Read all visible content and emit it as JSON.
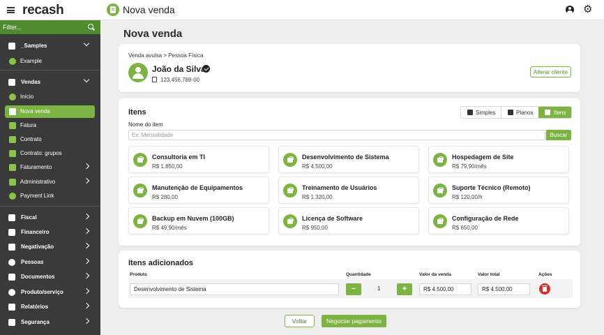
{
  "app": {
    "logo": "recash",
    "page_title": "Nova venda"
  },
  "sidebar": {
    "filter_placeholder": "Filter...",
    "groups": [
      {
        "label": "_Samples",
        "icon": "folder-icon"
      },
      {
        "label": "Example",
        "icon": "asterisk-icon"
      },
      {
        "label": "Vendas",
        "icon": "sales-icon"
      },
      {
        "label": "Início",
        "icon": "home-icon"
      },
      {
        "label": "Nova venda",
        "icon": "cart-icon",
        "active": true
      },
      {
        "label": "Fatura",
        "icon": "invoice-icon"
      },
      {
        "label": "Contrato",
        "icon": "contract-icon"
      },
      {
        "label": "Contrato: grupos",
        "icon": "contract-groups-icon"
      },
      {
        "label": "Faturamento",
        "icon": "billing-icon"
      },
      {
        "label": "Administrativo",
        "icon": "admin-icon"
      },
      {
        "label": "Payment Link",
        "icon": "link-icon"
      },
      {
        "label": "Fiscal",
        "icon": "fiscal-icon"
      },
      {
        "label": "Financeiro",
        "icon": "finance-icon"
      },
      {
        "label": "Negativação",
        "icon": "negative-icon"
      },
      {
        "label": "Pessoas",
        "icon": "people-icon"
      },
      {
        "label": "Documentos",
        "icon": "documents-icon"
      },
      {
        "label": "Produto/serviço",
        "icon": "product-icon"
      },
      {
        "label": "Relatórios",
        "icon": "reports-icon"
      },
      {
        "label": "Segurança",
        "icon": "lock-icon"
      }
    ]
  },
  "main": {
    "title": "Nova venda"
  },
  "client": {
    "breadcrumb": "Venda avulsa > Pessoa Física",
    "name": "João da Silva",
    "document": "123.456.789-00",
    "change_label": "Alterar cliente"
  },
  "items": {
    "title": "Itens",
    "toggles": [
      "Simples",
      "Planos",
      "Itens"
    ],
    "selected_toggle": "Itens",
    "field_label": "Nome do item",
    "field_placeholder": "Ex: Mensalidade",
    "search_label": "Buscar",
    "products": [
      {
        "name": "Consultoria em TI",
        "price": "R$ 1.850,00"
      },
      {
        "name": "Desenvolvimento de Sistema",
        "price": "R$ 4.500,00"
      },
      {
        "name": "Hospedagem de Site",
        "price": "R$ 79,90/mês"
      },
      {
        "name": "Manutenção de Equipamentos",
        "price": "R$ 280,00"
      },
      {
        "name": "Treinamento de Usuários",
        "price": "R$ 1.320,00"
      },
      {
        "name": "Suporte Técnico (Remoto)",
        "price": "R$ 120,00/h"
      },
      {
        "name": "Backup em Nuvem (100GB)",
        "price": "R$ 49,90/mês"
      },
      {
        "name": "Licença de Software",
        "price": "R$ 950,00"
      },
      {
        "name": "Configuração de Rede",
        "price": "R$ 650,00"
      }
    ]
  },
  "added": {
    "title": "Itens adicionados",
    "columns": [
      "Produto",
      "Quantidade",
      "Valor da venda",
      "Valor total",
      "Ações"
    ],
    "row": {
      "product": "Desenvolvimento de Sistema",
      "quantity": "1",
      "sale_value": "R$ 4.500,00",
      "total_value": "R$ 4.500,00"
    },
    "minus_label": "−",
    "plus_label": "+"
  },
  "footer": {
    "back_label": "Voltar",
    "next_label": "Negociar pagamento"
  },
  "colors": {
    "accent": "#7cb342",
    "accent_dark": "#4e8a2e",
    "sidebar": "#3a3a3a",
    "danger": "#d32f2f"
  }
}
